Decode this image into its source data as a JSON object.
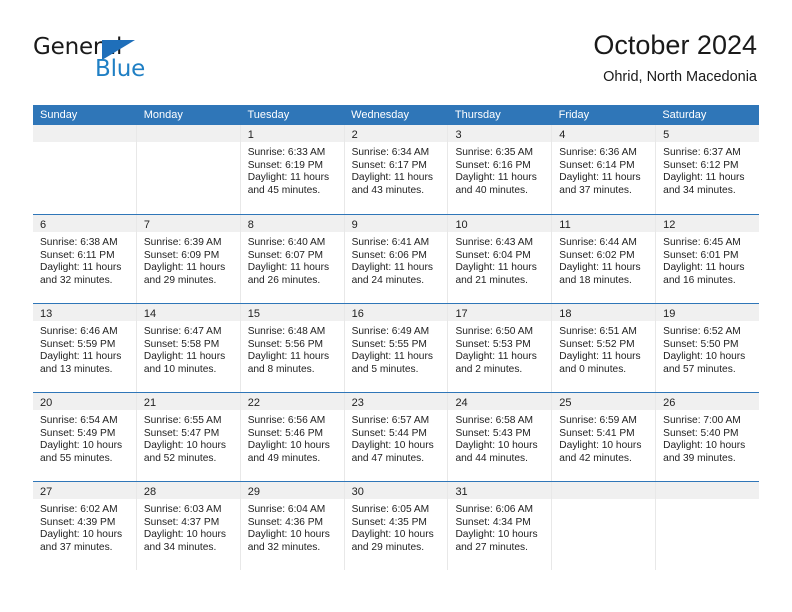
{
  "brand": {
    "name_top": "General",
    "name_bottom": "Blue",
    "accent_color": "#1f7fc4",
    "triangle_color": "#1f6fba"
  },
  "header": {
    "title": "October 2024",
    "subtitle": "Ohrid, North Macedonia"
  },
  "theme": {
    "header_bg": "#2f76b8",
    "header_text": "#ffffff",
    "day_band_bg": "#f0f0f0",
    "week_divider": "#2f76b8",
    "column_divider": "#e8e8e8",
    "text": "#222222"
  },
  "weekday_headers": [
    "Sunday",
    "Monday",
    "Tuesday",
    "Wednesday",
    "Thursday",
    "Friday",
    "Saturday"
  ],
  "weeks": [
    [
      {
        "day": "",
        "lines": []
      },
      {
        "day": "",
        "lines": []
      },
      {
        "day": "1",
        "lines": [
          "Sunrise: 6:33 AM",
          "Sunset: 6:19 PM",
          "Daylight: 11 hours",
          "and 45 minutes."
        ]
      },
      {
        "day": "2",
        "lines": [
          "Sunrise: 6:34 AM",
          "Sunset: 6:17 PM",
          "Daylight: 11 hours",
          "and 43 minutes."
        ]
      },
      {
        "day": "3",
        "lines": [
          "Sunrise: 6:35 AM",
          "Sunset: 6:16 PM",
          "Daylight: 11 hours",
          "and 40 minutes."
        ]
      },
      {
        "day": "4",
        "lines": [
          "Sunrise: 6:36 AM",
          "Sunset: 6:14 PM",
          "Daylight: 11 hours",
          "and 37 minutes."
        ]
      },
      {
        "day": "5",
        "lines": [
          "Sunrise: 6:37 AM",
          "Sunset: 6:12 PM",
          "Daylight: 11 hours",
          "and 34 minutes."
        ]
      }
    ],
    [
      {
        "day": "6",
        "lines": [
          "Sunrise: 6:38 AM",
          "Sunset: 6:11 PM",
          "Daylight: 11 hours",
          "and 32 minutes."
        ]
      },
      {
        "day": "7",
        "lines": [
          "Sunrise: 6:39 AM",
          "Sunset: 6:09 PM",
          "Daylight: 11 hours",
          "and 29 minutes."
        ]
      },
      {
        "day": "8",
        "lines": [
          "Sunrise: 6:40 AM",
          "Sunset: 6:07 PM",
          "Daylight: 11 hours",
          "and 26 minutes."
        ]
      },
      {
        "day": "9",
        "lines": [
          "Sunrise: 6:41 AM",
          "Sunset: 6:06 PM",
          "Daylight: 11 hours",
          "and 24 minutes."
        ]
      },
      {
        "day": "10",
        "lines": [
          "Sunrise: 6:43 AM",
          "Sunset: 6:04 PM",
          "Daylight: 11 hours",
          "and 21 minutes."
        ]
      },
      {
        "day": "11",
        "lines": [
          "Sunrise: 6:44 AM",
          "Sunset: 6:02 PM",
          "Daylight: 11 hours",
          "and 18 minutes."
        ]
      },
      {
        "day": "12",
        "lines": [
          "Sunrise: 6:45 AM",
          "Sunset: 6:01 PM",
          "Daylight: 11 hours",
          "and 16 minutes."
        ]
      }
    ],
    [
      {
        "day": "13",
        "lines": [
          "Sunrise: 6:46 AM",
          "Sunset: 5:59 PM",
          "Daylight: 11 hours",
          "and 13 minutes."
        ]
      },
      {
        "day": "14",
        "lines": [
          "Sunrise: 6:47 AM",
          "Sunset: 5:58 PM",
          "Daylight: 11 hours",
          "and 10 minutes."
        ]
      },
      {
        "day": "15",
        "lines": [
          "Sunrise: 6:48 AM",
          "Sunset: 5:56 PM",
          "Daylight: 11 hours",
          "and 8 minutes."
        ]
      },
      {
        "day": "16",
        "lines": [
          "Sunrise: 6:49 AM",
          "Sunset: 5:55 PM",
          "Daylight: 11 hours",
          "and 5 minutes."
        ]
      },
      {
        "day": "17",
        "lines": [
          "Sunrise: 6:50 AM",
          "Sunset: 5:53 PM",
          "Daylight: 11 hours",
          "and 2 minutes."
        ]
      },
      {
        "day": "18",
        "lines": [
          "Sunrise: 6:51 AM",
          "Sunset: 5:52 PM",
          "Daylight: 11 hours",
          "and 0 minutes."
        ]
      },
      {
        "day": "19",
        "lines": [
          "Sunrise: 6:52 AM",
          "Sunset: 5:50 PM",
          "Daylight: 10 hours",
          "and 57 minutes."
        ]
      }
    ],
    [
      {
        "day": "20",
        "lines": [
          "Sunrise: 6:54 AM",
          "Sunset: 5:49 PM",
          "Daylight: 10 hours",
          "and 55 minutes."
        ]
      },
      {
        "day": "21",
        "lines": [
          "Sunrise: 6:55 AM",
          "Sunset: 5:47 PM",
          "Daylight: 10 hours",
          "and 52 minutes."
        ]
      },
      {
        "day": "22",
        "lines": [
          "Sunrise: 6:56 AM",
          "Sunset: 5:46 PM",
          "Daylight: 10 hours",
          "and 49 minutes."
        ]
      },
      {
        "day": "23",
        "lines": [
          "Sunrise: 6:57 AM",
          "Sunset: 5:44 PM",
          "Daylight: 10 hours",
          "and 47 minutes."
        ]
      },
      {
        "day": "24",
        "lines": [
          "Sunrise: 6:58 AM",
          "Sunset: 5:43 PM",
          "Daylight: 10 hours",
          "and 44 minutes."
        ]
      },
      {
        "day": "25",
        "lines": [
          "Sunrise: 6:59 AM",
          "Sunset: 5:41 PM",
          "Daylight: 10 hours",
          "and 42 minutes."
        ]
      },
      {
        "day": "26",
        "lines": [
          "Sunrise: 7:00 AM",
          "Sunset: 5:40 PM",
          "Daylight: 10 hours",
          "and 39 minutes."
        ]
      }
    ],
    [
      {
        "day": "27",
        "lines": [
          "Sunrise: 6:02 AM",
          "Sunset: 4:39 PM",
          "Daylight: 10 hours",
          "and 37 minutes."
        ]
      },
      {
        "day": "28",
        "lines": [
          "Sunrise: 6:03 AM",
          "Sunset: 4:37 PM",
          "Daylight: 10 hours",
          "and 34 minutes."
        ]
      },
      {
        "day": "29",
        "lines": [
          "Sunrise: 6:04 AM",
          "Sunset: 4:36 PM",
          "Daylight: 10 hours",
          "and 32 minutes."
        ]
      },
      {
        "day": "30",
        "lines": [
          "Sunrise: 6:05 AM",
          "Sunset: 4:35 PM",
          "Daylight: 10 hours",
          "and 29 minutes."
        ]
      },
      {
        "day": "31",
        "lines": [
          "Sunrise: 6:06 AM",
          "Sunset: 4:34 PM",
          "Daylight: 10 hours",
          "and 27 minutes."
        ]
      },
      {
        "day": "",
        "lines": []
      },
      {
        "day": "",
        "lines": []
      }
    ]
  ]
}
